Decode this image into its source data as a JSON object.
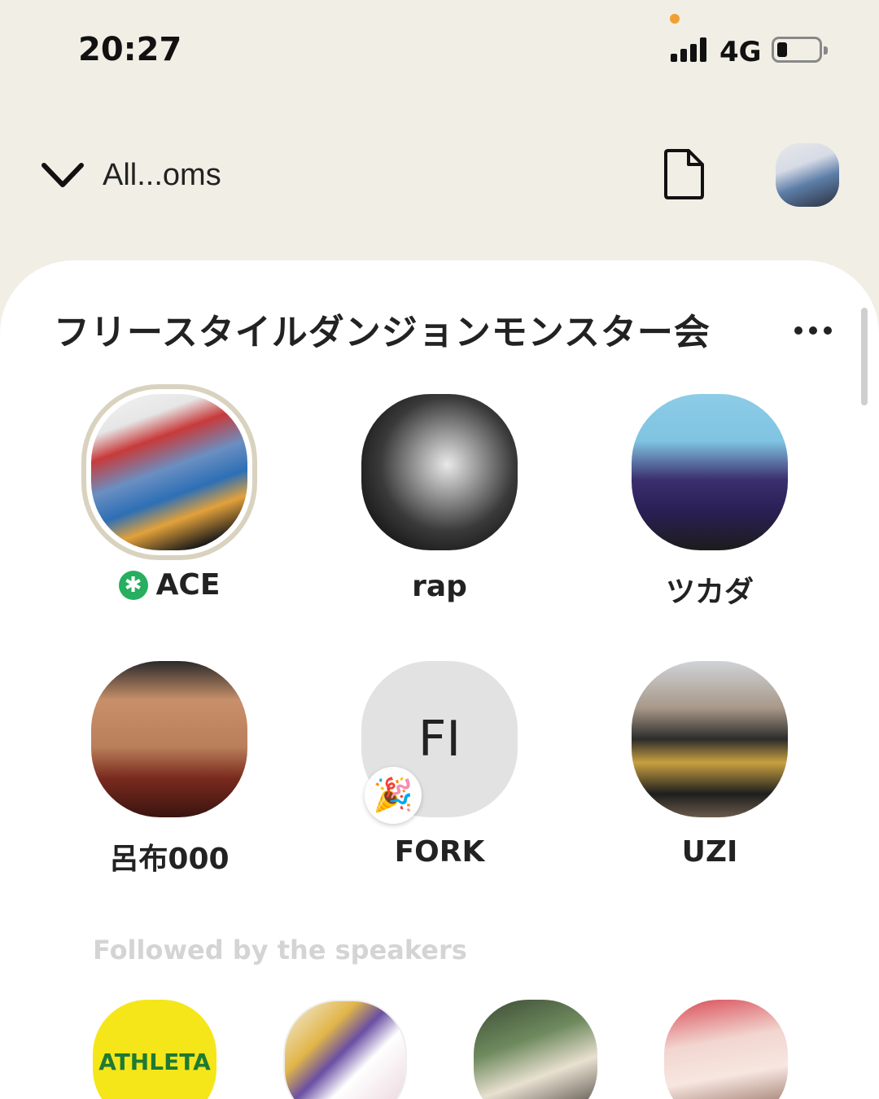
{
  "status_bar": {
    "time": "20:27",
    "network": "4G"
  },
  "header": {
    "room_selector_label": "All...oms"
  },
  "room": {
    "title": "フリースタイルダンジョンモンスター会",
    "speakers": [
      {
        "name": "ACE",
        "moderator": true
      },
      {
        "name": "rap"
      },
      {
        "name": "ツカダ"
      },
      {
        "name": "呂布000"
      },
      {
        "name": "FORK",
        "initials": "FI",
        "badge": "🎉"
      },
      {
        "name": "UZI"
      }
    ],
    "followed_section_label": "Followed by the speakers",
    "followers": [
      {
        "logo_text": "ATHLETA"
      },
      {},
      {},
      {}
    ]
  },
  "colors": {
    "background": "#f1efe5",
    "sheet": "#ffffff",
    "moderator_badge": "#27ae60",
    "speaker_ring": "#d9d2bf"
  }
}
